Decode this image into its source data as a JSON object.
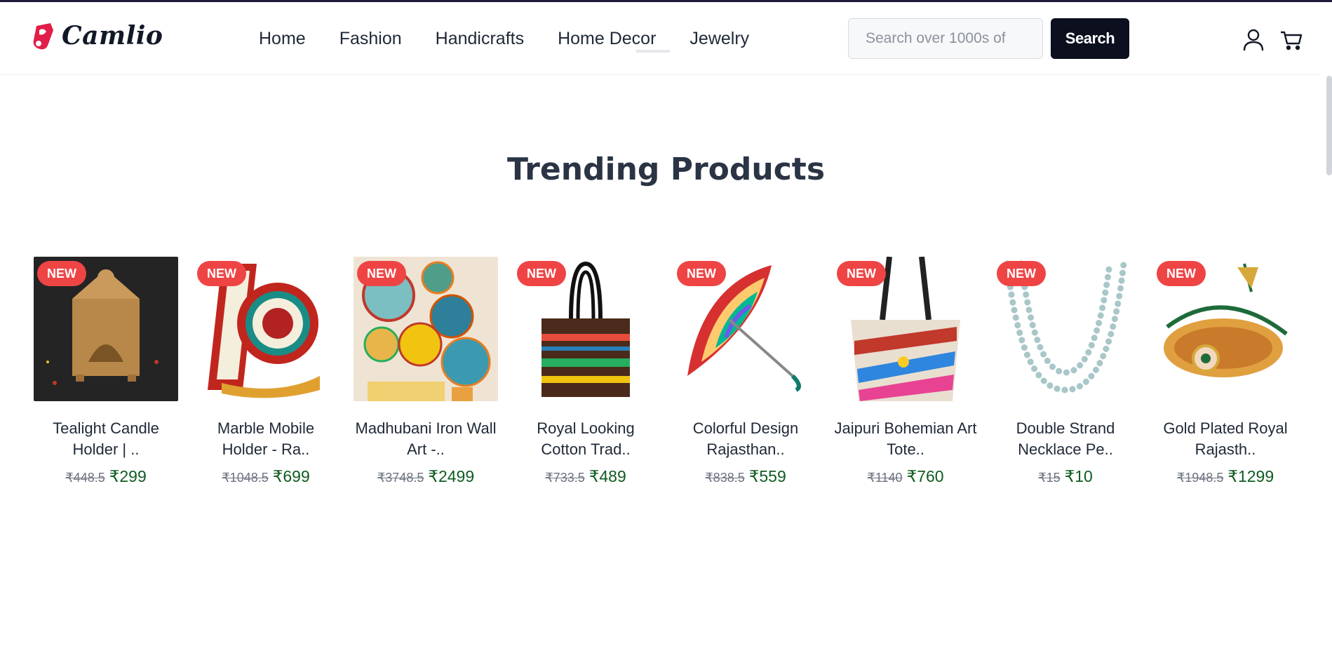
{
  "header": {
    "logo_text": "Camlio",
    "nav": [
      "Home",
      "Fashion",
      "Handicrafts",
      "Home Decor",
      "Jewelry"
    ],
    "search_placeholder": "Search over 1000s of",
    "search_button": "Search",
    "icons": [
      "user-icon",
      "cart-icon"
    ]
  },
  "section": {
    "title": "Trending Products"
  },
  "colors": {
    "badge": "#ef4444",
    "price": "#0f5b1f",
    "search_button": "#0b0f1e"
  },
  "products": [
    {
      "badge": "NEW",
      "name": "Tealight Candle Holder | ..",
      "old_price": "₹448.5",
      "price": "₹299"
    },
    {
      "badge": "NEW",
      "name": "Marble Mobile Holder - Ra..",
      "old_price": "₹1048.5",
      "price": "₹699"
    },
    {
      "badge": "NEW",
      "name": "Madhubani Iron Wall Art -..",
      "old_price": "₹3748.5",
      "price": "₹2499"
    },
    {
      "badge": "NEW",
      "name": "Royal Looking Cotton Trad..",
      "old_price": "₹733.5",
      "price": "₹489"
    },
    {
      "badge": "NEW",
      "name": "Colorful Design Rajasthan..",
      "old_price": "₹838.5",
      "price": "₹559"
    },
    {
      "badge": "NEW",
      "name": "Jaipuri Bohemian Art Tote..",
      "old_price": "₹1140",
      "price": "₹760"
    },
    {
      "badge": "NEW",
      "name": "Double Strand Necklace Pe..",
      "old_price": "₹15",
      "price": "₹10"
    },
    {
      "badge": "NEW",
      "name": "Gold Plated Royal Rajasth..",
      "old_price": "₹1948.5",
      "price": "₹1299"
    }
  ]
}
